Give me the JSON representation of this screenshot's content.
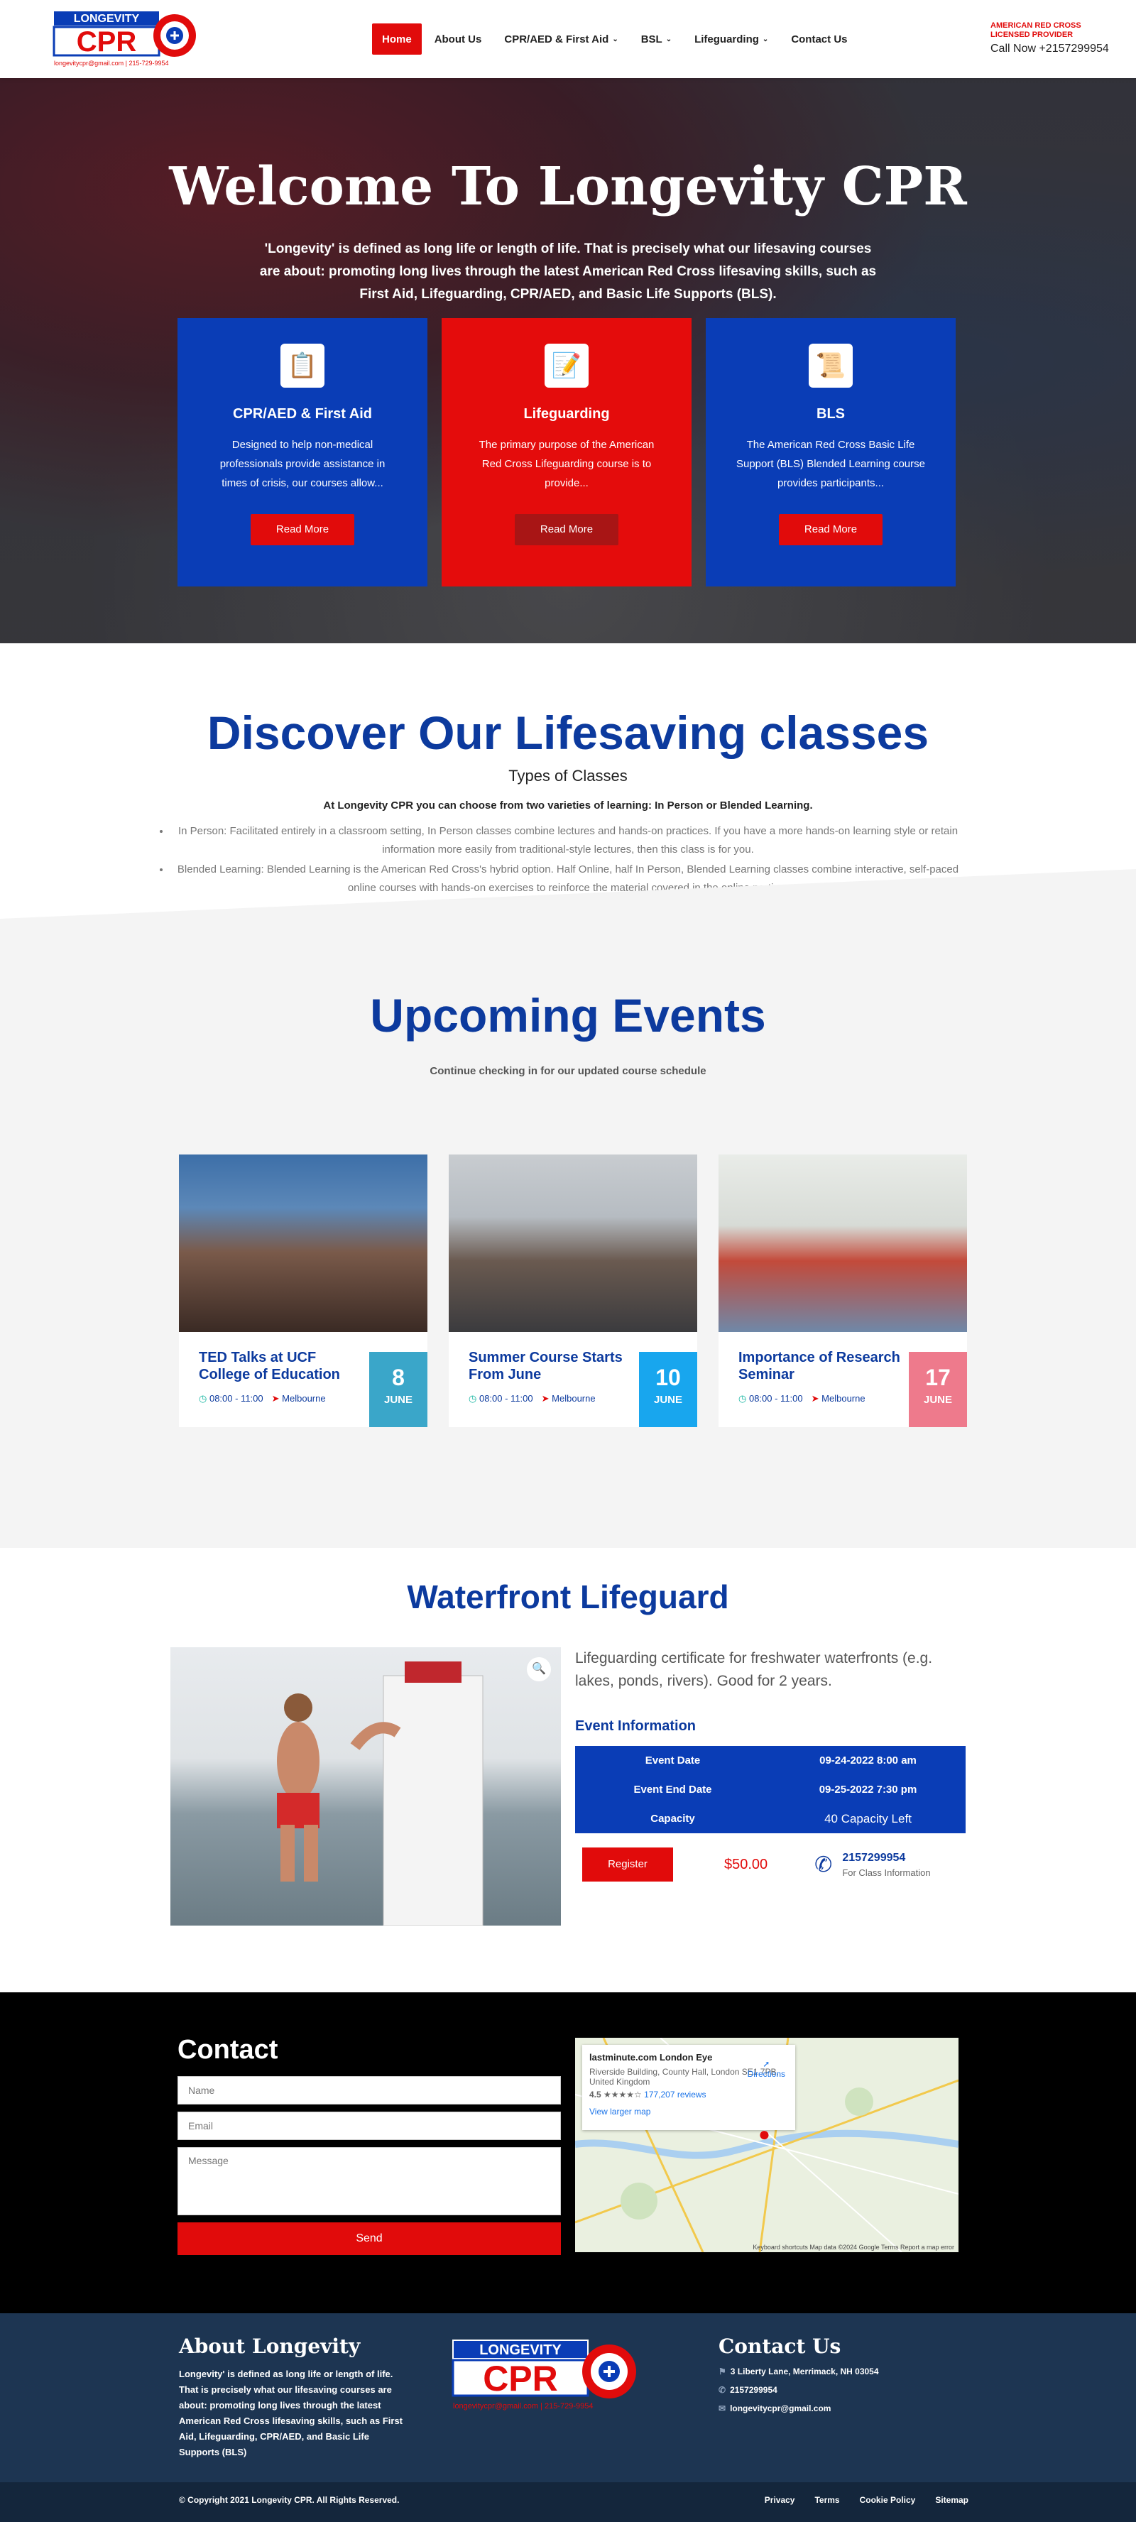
{
  "header": {
    "logo_text": "LONGEVITY CPR",
    "logo_email": "longevitycpr@gmail.com",
    "logo_phone": "215-729-9954",
    "nav": [
      {
        "label": "Home",
        "active": true,
        "dropdown": false
      },
      {
        "label": "About Us",
        "active": false,
        "dropdown": false
      },
      {
        "label": "CPR/AED & First Aid",
        "active": false,
        "dropdown": true
      },
      {
        "label": "BSL",
        "active": false,
        "dropdown": true
      },
      {
        "label": "Lifeguarding",
        "active": false,
        "dropdown": true
      },
      {
        "label": "Contact Us",
        "active": false,
        "dropdown": false
      }
    ],
    "license_line1": "AMERICAN RED CROSS",
    "license_line2": "LICENSED PROVIDER",
    "call": "Call Now +2157299954"
  },
  "hero": {
    "title": "Welcome To Longevity CPR",
    "description": "'Longevity' is defined as long life or length of life. That is precisely what our lifesaving courses are about: promoting long lives through the latest American Red Cross lifesaving skills, such as First Aid, Lifeguarding, CPR/AED, and Basic Life Supports (BLS).",
    "cards": [
      {
        "title": "CPR/AED & First Aid",
        "text": "Designed to help non-medical professionals provide assistance in times of crisis, our courses allow...",
        "button": "Read More",
        "icon": "clipboard-icon"
      },
      {
        "title": "Lifeguarding",
        "text": "The primary purpose of the American Red Cross Lifeguarding course is to provide...",
        "button": "Read More",
        "icon": "checklist-icon"
      },
      {
        "title": "BLS",
        "text": "The American Red Cross Basic Life Support (BLS) Blended Learning course provides participants...",
        "button": "Read More",
        "icon": "contract-icon"
      }
    ]
  },
  "discover": {
    "title": "Discover Our Lifesaving classes",
    "subtitle": "Types of Classes",
    "lead": "At Longevity CPR you can choose from two varieties of learning: In Person or Blended Learning.",
    "items": [
      "In Person: Facilitated entirely in a classroom setting, In Person classes combine lectures and hands-on practices. If you have a more hands-on learning style or retain information more easily from traditional-style lectures, then this class is for you.",
      "Blended Learning: Blended Learning is the American Red Cross's hybrid option. Half Online, half In Person, Blended Learning classes combine interactive, self-paced online courses with hands-on exercises to reinforce the material covered in the online portion."
    ]
  },
  "events": {
    "title": "Upcoming Events",
    "subtitle": "Continue checking in for our updated course schedule",
    "list": [
      {
        "title": "TED Talks at UCF College of Education",
        "time": "08:00 - 11:00",
        "location": "Melbourne",
        "day": "8",
        "month": "JUNE",
        "color": "#3aa6c9"
      },
      {
        "title": "Summer Course Starts From June",
        "time": "08:00 - 11:00",
        "location": "Melbourne",
        "day": "10",
        "month": "JUNE",
        "color": "#18a6ee"
      },
      {
        "title": "Importance of Research Seminar",
        "time": "08:00 - 11:00",
        "location": "Melbourne",
        "day": "17",
        "month": "JUNE",
        "color": "#ee7a8c"
      }
    ]
  },
  "lifeguard": {
    "title": "Waterfront Lifeguard",
    "description": "Lifeguarding certificate for freshwater waterfronts (e.g. lakes, ponds, rivers). Good for 2 years.",
    "info_heading": "Event Information",
    "rows": [
      {
        "label": "Event Date",
        "value": "09-24-2022 8:00 am"
      },
      {
        "label": "Event End Date",
        "value": "09-25-2022 7:30 pm"
      },
      {
        "label": "Capacity",
        "value": "40 Capacity Left"
      }
    ],
    "register": "Register",
    "price": "$50.00",
    "phone": "2157299954",
    "phone_note": "For Class Information"
  },
  "contact": {
    "title": "Contact",
    "name_placeholder": "Name",
    "email_placeholder": "Email",
    "message_placeholder": "Message",
    "send": "Send",
    "map": {
      "place": "lastminute.com London Eye",
      "address": "Riverside Building, County Hall, London SE1 7PB, United Kingdom",
      "rating": "4.5",
      "reviews": "177,207 reviews",
      "view_larger": "View larger map",
      "directions": "Directions",
      "footer": "Keyboard shortcuts   Map data ©2024 Google   Terms   Report a map error"
    }
  },
  "footer": {
    "about_title": "About Longevity",
    "about_text": "Longevity' is defined as long life or length of life. That is precisely what our lifesaving courses are about: promoting long lives through the latest American Red Cross lifesaving skills, such as First Aid, Lifeguarding, CPR/AED, and Basic Life Supports (BLS)",
    "contact_title": "Contact Us",
    "address": "3 Liberty Lane, Merrimack, NH 03054",
    "phone": "2157299954",
    "email": "longevitycpr@gmail.com",
    "copyright": "© Copyright 2021 Longevity CPR. All Rights Reserved.",
    "links": [
      "Privacy",
      "Terms",
      "Cookie Policy",
      "Sitemap"
    ]
  }
}
